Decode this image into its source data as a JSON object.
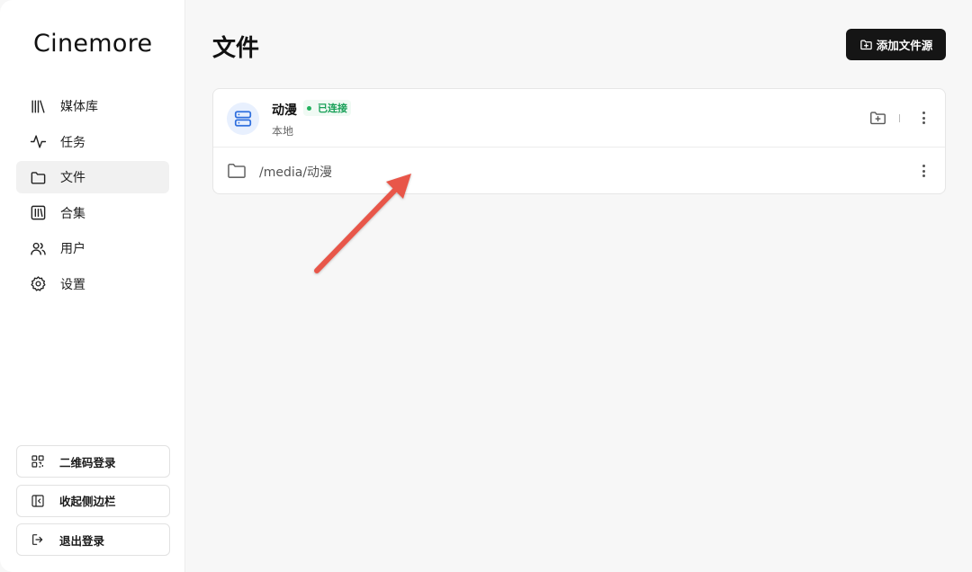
{
  "app": {
    "brand": "Cinemore"
  },
  "sidebar": {
    "items": [
      {
        "label": "媒体库",
        "icon": "library-icon",
        "active": false
      },
      {
        "label": "任务",
        "icon": "activity-icon",
        "active": false
      },
      {
        "label": "文件",
        "icon": "folder-icon",
        "active": true
      },
      {
        "label": "合集",
        "icon": "collection-icon",
        "active": false
      },
      {
        "label": "用户",
        "icon": "users-icon",
        "active": false
      },
      {
        "label": "设置",
        "icon": "gear-icon",
        "active": false
      }
    ],
    "bottom": {
      "qr_login": "二维码登录",
      "collapse": "收起侧边栏",
      "logout": "退出登录"
    }
  },
  "main": {
    "title": "文件",
    "add_source_label": "添加文件源",
    "source": {
      "name": "动漫",
      "status": "已连接",
      "status_color": "#18a058",
      "type": "本地",
      "paths": [
        "/media/动漫"
      ]
    }
  },
  "colors": {
    "accent_dark": "#151515",
    "server_icon": "#2f6fde",
    "arrow": "#e8574a"
  }
}
